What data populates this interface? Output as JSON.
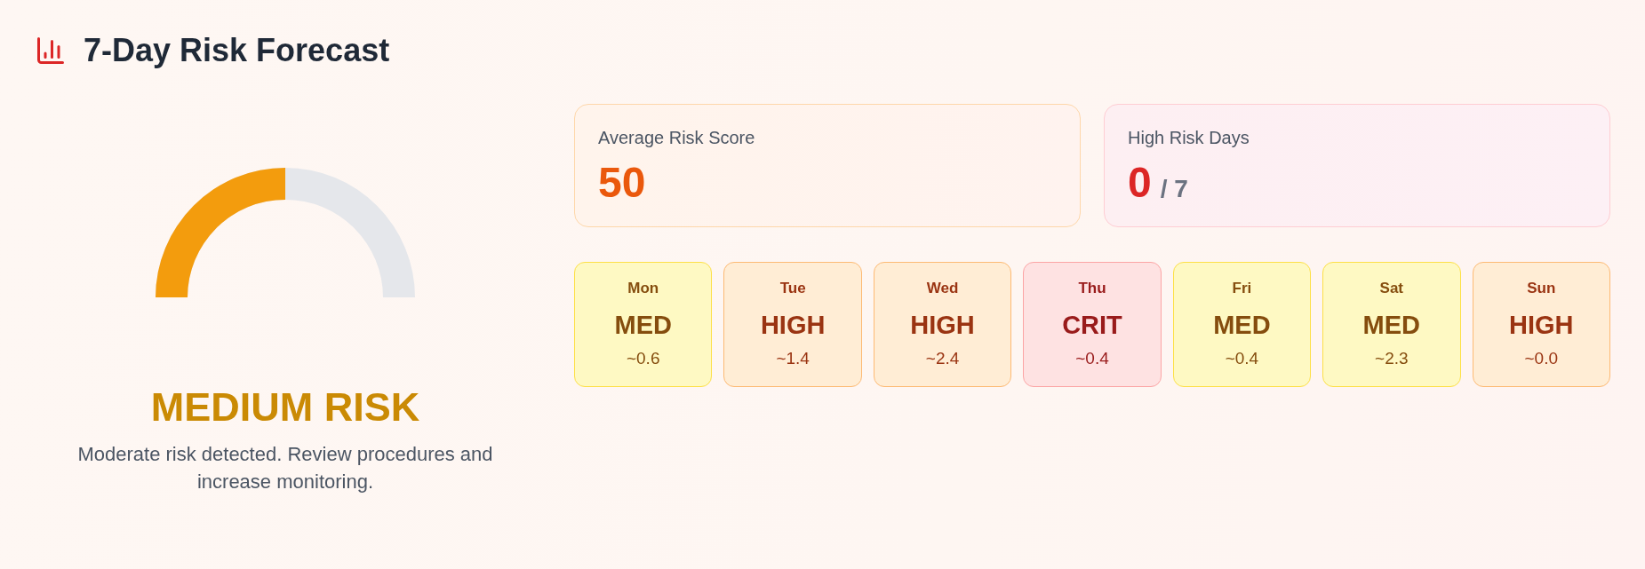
{
  "header": {
    "title": "7-Day Risk Forecast"
  },
  "risk": {
    "kind": "medium",
    "level": 0.5,
    "label": "MEDIUM RISK",
    "description": "Moderate risk detected. Review procedures and increase monitoring."
  },
  "stats": [
    {
      "kind": "score",
      "label": "Average Risk Score",
      "value": "50"
    },
    {
      "kind": "days",
      "label": "High Risk Days",
      "value": "0",
      "total": "/ 7"
    }
  ],
  "days": [
    {
      "day": "Mon",
      "kind": "medium",
      "rating": "MED",
      "value": "~0.6"
    },
    {
      "day": "Tue",
      "kind": "high",
      "rating": "HIGH",
      "value": "~1.4"
    },
    {
      "day": "Wed",
      "kind": "high",
      "rating": "HIGH",
      "value": "~2.4"
    },
    {
      "day": "Thu",
      "kind": "critical",
      "rating": "CRIT",
      "value": "~0.4"
    },
    {
      "day": "Fri",
      "kind": "medium",
      "rating": "MED",
      "value": "~0.4"
    },
    {
      "day": "Sat",
      "kind": "medium",
      "rating": "MED",
      "value": "~2.3"
    },
    {
      "day": "Sun",
      "kind": "high",
      "rating": "HIGH",
      "value": "~0.0"
    }
  ]
}
